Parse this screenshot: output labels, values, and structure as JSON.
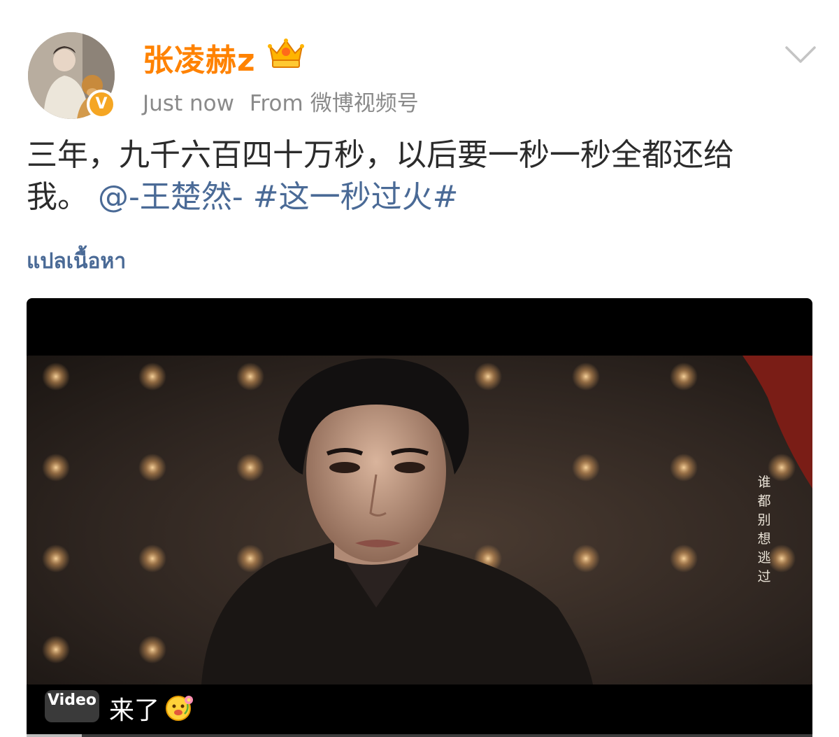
{
  "post": {
    "username": "张凌赫z",
    "timestamp": "Just now",
    "source_label": "From",
    "source_name": "微博视频号",
    "verified_badge": "V",
    "text": {
      "line1": "三年，九千六百四十万秒，以后要一秒一秒全都还给",
      "line2_prefix": "我。",
      "mention": "@-王楚然-",
      "hashtag": "#这一秒过火#"
    },
    "translate_label": "แปลเนื้อหา"
  },
  "video": {
    "badge_label": "Video",
    "caption": "来了",
    "subtitle_chars": [
      "谁",
      "都",
      "别",
      "想",
      "逃",
      "过"
    ],
    "progress": 0.07
  },
  "icons": {
    "crown": "crown-level-icon",
    "more": "chevron-down-icon",
    "emoji": "flower-face-emoji-icon"
  },
  "colors": {
    "username": "#ff8200",
    "link": "#4a6a96",
    "verified": "#f5a623",
    "meta": "#8a8a8a"
  }
}
